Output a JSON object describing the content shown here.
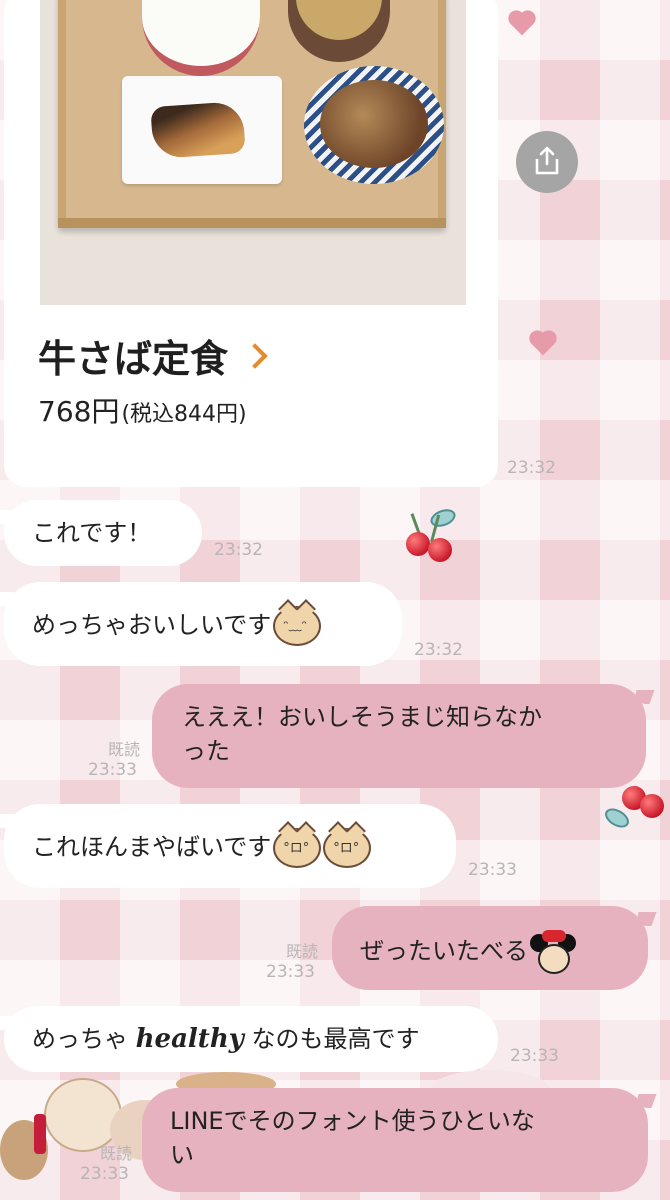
{
  "product": {
    "name": "牛さば定食",
    "price": "768円",
    "price_tax": "(税込844円)",
    "time": "23:32"
  },
  "messages": [
    {
      "side": "in",
      "text": "これです！",
      "time": "23:32"
    },
    {
      "side": "in",
      "text": "めっちゃおいしいです",
      "emoji": "cat-face-icon",
      "time": "23:32"
    },
    {
      "side": "out",
      "line1": "えええ！おいしそうまじ知らなか",
      "line2": "った",
      "read": "既読",
      "time": "23:33"
    },
    {
      "side": "in",
      "text": "これほんまやばいです",
      "emoji": "cat-face-icon x2",
      "time": "23:33"
    },
    {
      "side": "out",
      "text": "ぜったいたべる",
      "emoji": "minnie-mouse-icon",
      "read": "既読",
      "time": "23:33"
    },
    {
      "side": "in",
      "text_before": "めっちゃ ",
      "text_styled": "healthy",
      "text_after": " なのも最高です",
      "time": "23:33"
    },
    {
      "side": "out",
      "line1": "LINEでそのフォント使うひといな",
      "line2": "い",
      "read": "既読",
      "time": "23:33"
    }
  ],
  "emoji_faces": {
    "cat": "ᵔ﹏ᵔ",
    "cat_cry": "°ロ°"
  },
  "colors": {
    "out_bubble": "#e7b2bf",
    "in_bubble": "#ffffff",
    "accent_chevron": "#e48b2c",
    "timestamp": "#b9b4b6"
  }
}
